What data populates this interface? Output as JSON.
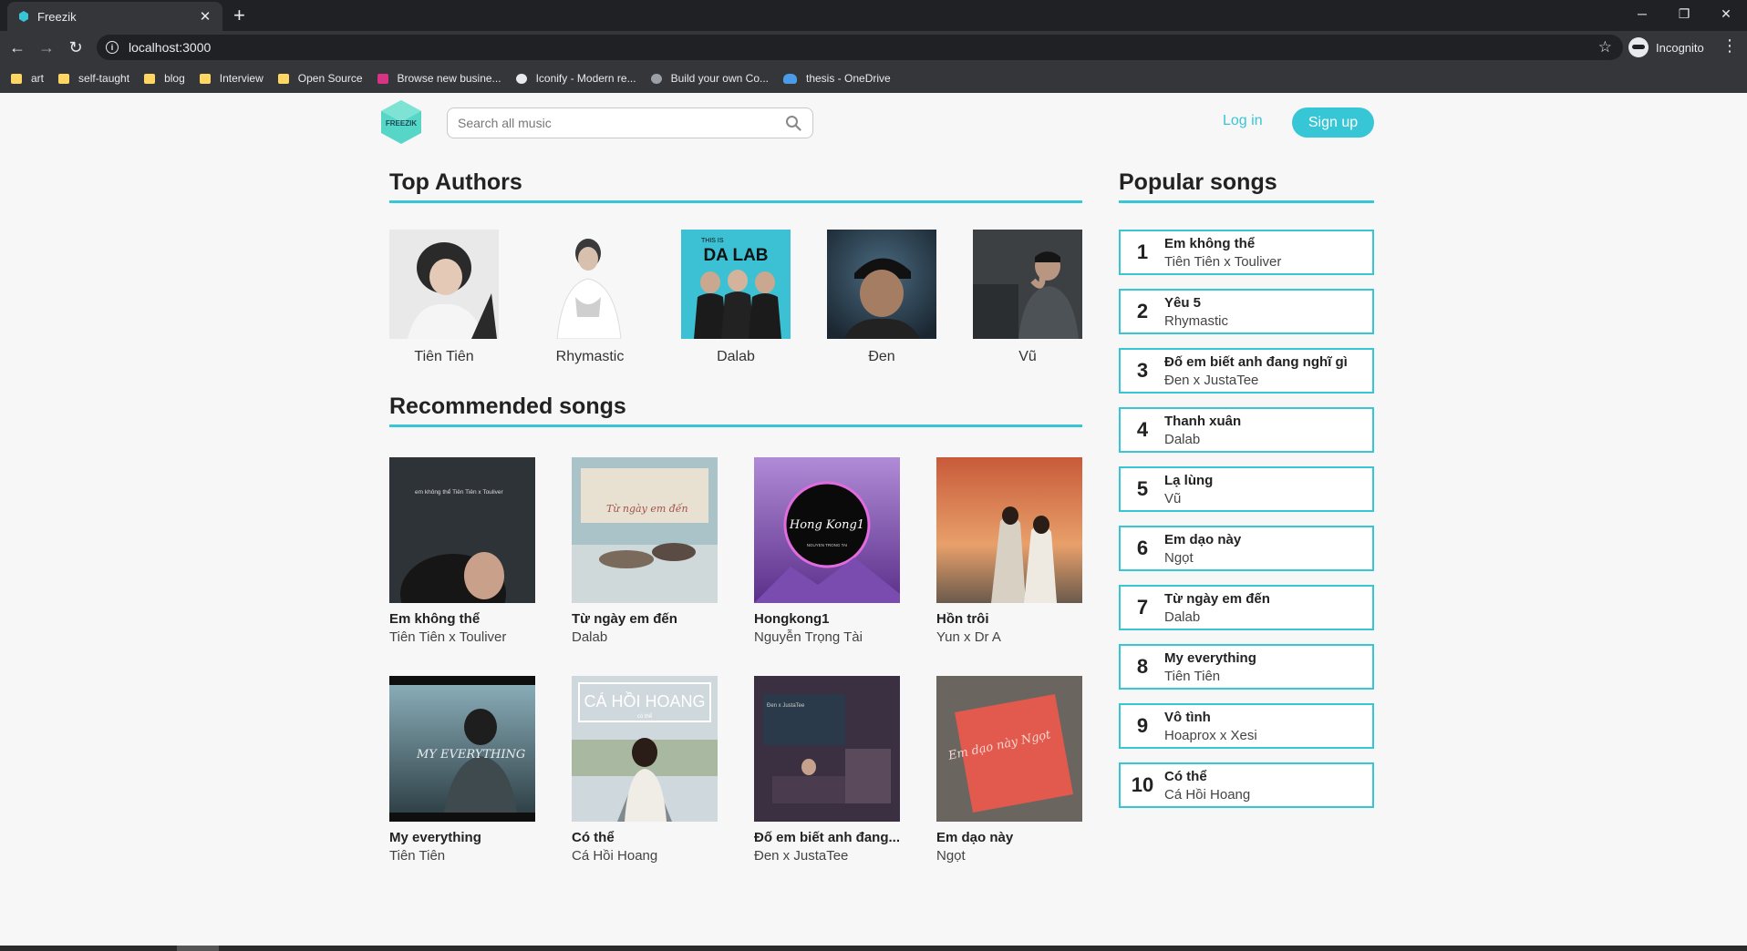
{
  "browser": {
    "tab_title": "Freezik",
    "tab_close": "✕",
    "new_tab": "+",
    "url": "localhost:3000",
    "profile": "Incognito",
    "window_controls": {
      "minimize": "─",
      "restore": "❐",
      "close": "✕"
    },
    "bookmarks": [
      {
        "label": "art",
        "icon": "folder-icon"
      },
      {
        "label": "self-taught",
        "icon": "folder-icon"
      },
      {
        "label": "blog",
        "icon": "folder-icon"
      },
      {
        "label": "Interview",
        "icon": "folder-icon"
      },
      {
        "label": "Open Source",
        "icon": "folder-icon"
      },
      {
        "label": "Browse new busine...",
        "icon": "site-icon"
      },
      {
        "label": "Iconify - Modern re...",
        "icon": "smiley-icon"
      },
      {
        "label": "Build your own Co...",
        "icon": "gear-icon"
      },
      {
        "label": "thesis - OneDrive",
        "icon": "cloud-icon"
      }
    ]
  },
  "header": {
    "logo_text": "FREEZIK",
    "search_placeholder": "Search all music",
    "login_label": "Log in",
    "signup_label": "Sign up"
  },
  "colors": {
    "accent": "#37c6d6",
    "text": "#222222",
    "background": "#f7f7f7"
  },
  "top_authors": {
    "title": "Top Authors",
    "items": [
      {
        "name": "Tiên Tiên"
      },
      {
        "name": "Rhymastic"
      },
      {
        "name": "Dalab",
        "cover_text": "DA LAB",
        "cover_small": "THIS IS"
      },
      {
        "name": "Đen"
      },
      {
        "name": "Vũ"
      }
    ]
  },
  "recommended": {
    "title": "Recommended songs",
    "items": [
      {
        "title": "Em không thể",
        "artist": "Tiên Tiên x Touliver",
        "cover_text": "em không thể  Tiên Tiên x Touliver"
      },
      {
        "title": "Từ ngày em đến",
        "artist": "Dalab",
        "cover_text": "Từ ngày em đến"
      },
      {
        "title": "Hongkong1",
        "artist": "Nguyễn Trọng Tài",
        "cover_text": "Hong Kong1",
        "cover_small": "NGUYEN TRONG TAI"
      },
      {
        "title": "Hồn trôi",
        "artist": "Yun x Dr A"
      },
      {
        "title": "My everything",
        "artist": "Tiên Tiên",
        "cover_text": "MY EVERYTHING"
      },
      {
        "title": "Có thể",
        "artist": "Cá Hồi Hoang",
        "cover_text": "CÁ HỒI HOANG",
        "cover_small": "có thể"
      },
      {
        "title": "Đố em biết anh đang...",
        "artist": "Đen x JustaTee",
        "cover_text": "Đen x JustaTee"
      },
      {
        "title": "Em dạo này",
        "artist": "Ngọt",
        "cover_text": "Em dạo này Ngọt"
      }
    ]
  },
  "popular": {
    "title": "Popular songs",
    "items": [
      {
        "rank": "1",
        "title": "Em không thể",
        "artist": "Tiên Tiên x Touliver"
      },
      {
        "rank": "2",
        "title": "Yêu 5",
        "artist": "Rhymastic"
      },
      {
        "rank": "3",
        "title": "Đố em biết anh đang nghĩ gì",
        "artist": "Đen x JustaTee"
      },
      {
        "rank": "4",
        "title": "Thanh xuân",
        "artist": "Dalab"
      },
      {
        "rank": "5",
        "title": "Lạ lùng",
        "artist": "Vũ"
      },
      {
        "rank": "6",
        "title": "Em dạo này",
        "artist": "Ngọt"
      },
      {
        "rank": "7",
        "title": "Từ ngày em đến",
        "artist": "Dalab"
      },
      {
        "rank": "8",
        "title": "My everything",
        "artist": "Tiên Tiên"
      },
      {
        "rank": "9",
        "title": "Vô tình",
        "artist": "Hoaprox x Xesi"
      },
      {
        "rank": "10",
        "title": "Có thể",
        "artist": "Cá Hồi Hoang"
      }
    ]
  }
}
